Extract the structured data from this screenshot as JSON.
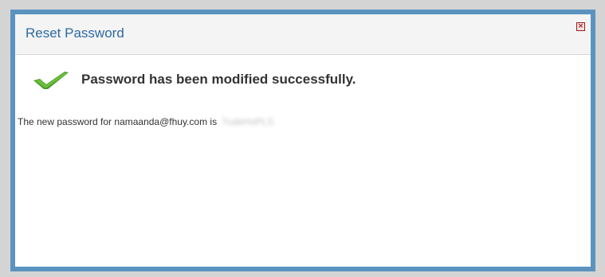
{
  "dialog": {
    "title": "Reset Password",
    "close_icon": "close-icon",
    "check_icon": "checkmark-icon",
    "success_message": "Password has been modified successfully.",
    "password_line_prefix": "The new password for namaanda@fhuy.com is",
    "password_value": "TudeHoPLS"
  },
  "colors": {
    "border": "#5b93c0",
    "title": "#2d6aa0",
    "check": "#4a9a2a",
    "close": "#b3120f"
  }
}
